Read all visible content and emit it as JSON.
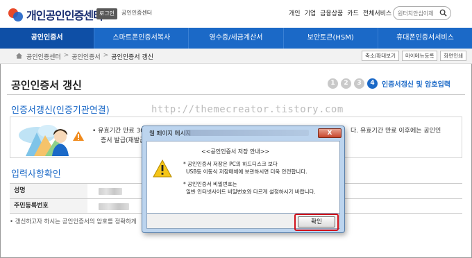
{
  "header": {
    "logo_text": "개인공인인증센터",
    "login_label": "로그인",
    "site_sub": "공인인증센터",
    "topnav": [
      "개인",
      "기업",
      "금융상품",
      "카드",
      "전체서비스"
    ],
    "search_placeholder": "원터치안심이체"
  },
  "mainnav": {
    "tabs": [
      "공인인증서",
      "스마트폰인증서복사",
      "영수증/세금계산서",
      "보안토큰(HSM)",
      "휴대폰인증서서비스"
    ],
    "active_index": 0
  },
  "breadcrumb": {
    "items": [
      "공인인증센터",
      "공인인증서",
      "공인인증서 갱신"
    ],
    "separator": ">",
    "buttons": [
      "축소/확대보기",
      "마이메뉴등록",
      "화면인쇄"
    ]
  },
  "page": {
    "title": "공인인증서 갱신",
    "steps": [
      "1",
      "2",
      "3",
      "4"
    ],
    "active_step": 4,
    "step_label": "인증서갱신 및 암호입력"
  },
  "section1": {
    "title": "인증서갱신(인증기관연결)",
    "line1_start": "• 유효기간 만료 30",
    "line1_end": "다. 유효기간 만료 이후에는 공인인",
    "line2": "증서 발급(재발급"
  },
  "watermark": "http://themecreator.tistory.com",
  "section2": {
    "title": "입력사항확인",
    "rows": [
      {
        "label": "성명"
      },
      {
        "label": "주민등록번호"
      }
    ],
    "footnote": "• 갱신하고자 하시는 공인인증서의 암호를 정확하게"
  },
  "dialog": {
    "title": "웹 페이지 메시지",
    "close_label": "X",
    "heading": "<<공인인증서 저장 안내>>",
    "lines": [
      "* 공인인증서 저장은 PC의 하드디스크 보다",
      "USB등 이동식 저장매체에 보관하시면 더욱 안전합니다.",
      "* 공인인증서 비밀번호는",
      "일반 인터넷사이트 비밀번호와 다르게 설정하시기 바랍니다."
    ],
    "ok_label": "확인"
  },
  "colors": {
    "brand_blue": "#1b69c7",
    "nav_active": "#0e4fa6",
    "highlight_red": "#d0101a"
  }
}
